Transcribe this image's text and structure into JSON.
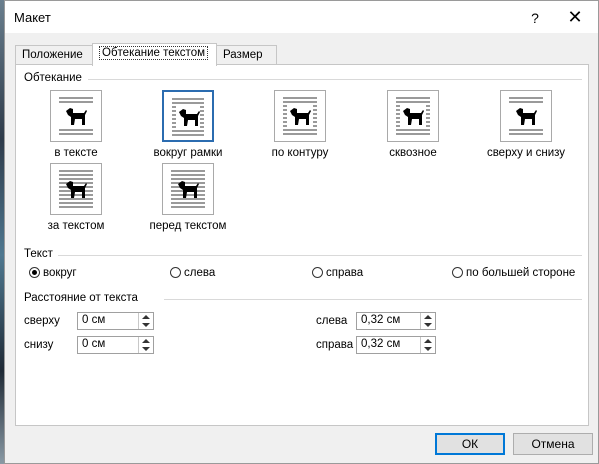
{
  "window": {
    "title": "Макет",
    "help_label": "?",
    "close_label": "✕"
  },
  "tabs": [
    "Положение",
    "Обтекание текстом",
    "Размер"
  ],
  "wrapping": {
    "group_label": "Обтекание",
    "options": [
      "в тексте",
      "вокруг рамки",
      "по контуру",
      "сквозное",
      "сверху и снизу",
      "за текстом",
      "перед текстом"
    ],
    "selected": "вокруг рамки"
  },
  "text_side": {
    "group_label": "Текст",
    "options": [
      "вокруг",
      "слева",
      "справа",
      "по большей стороне"
    ],
    "selected": "вокруг"
  },
  "distance": {
    "group_label": "Расстояние от текста",
    "top_label": "сверху",
    "top_value": "0 см",
    "bottom_label": "снизу",
    "bottom_value": "0 см",
    "left_label": "слева",
    "left_value": "0,32 см",
    "right_label": "справа",
    "right_value": "0,32 см"
  },
  "buttons": {
    "ok": "ОК",
    "cancel": "Отмена"
  },
  "colors": {
    "selection_border": "#2b6cb0",
    "default_button_border": "#0078d7"
  }
}
